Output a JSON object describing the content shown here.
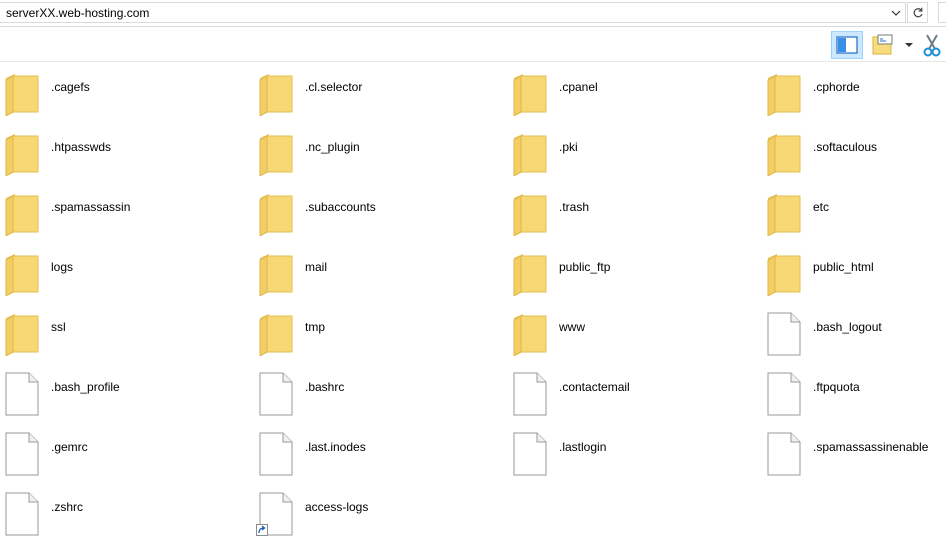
{
  "address": {
    "path": "serverXX.web-hosting.com",
    "dropdown_icon": "chevron-down-icon",
    "refresh_icon": "refresh-icon"
  },
  "toolbar": {
    "preview_pane_icon": "preview-pane-icon",
    "view_icon": "view-options-icon",
    "cut_icon": "scissors-icon",
    "accent": "#cce8ff"
  },
  "files": [
    {
      "name": ".cagefs",
      "type": "folder"
    },
    {
      "name": ".cl.selector",
      "type": "folder"
    },
    {
      "name": ".cpanel",
      "type": "folder"
    },
    {
      "name": ".cphorde",
      "type": "folder"
    },
    {
      "name": ".htpasswds",
      "type": "folder"
    },
    {
      "name": ".nc_plugin",
      "type": "folder"
    },
    {
      "name": ".pki",
      "type": "folder"
    },
    {
      "name": ".softaculous",
      "type": "folder"
    },
    {
      "name": ".spamassassin",
      "type": "folder"
    },
    {
      "name": ".subaccounts",
      "type": "folder"
    },
    {
      "name": ".trash",
      "type": "folder"
    },
    {
      "name": "etc",
      "type": "folder"
    },
    {
      "name": "logs",
      "type": "folder"
    },
    {
      "name": "mail",
      "type": "folder"
    },
    {
      "name": "public_ftp",
      "type": "folder"
    },
    {
      "name": "public_html",
      "type": "folder"
    },
    {
      "name": "ssl",
      "type": "folder"
    },
    {
      "name": "tmp",
      "type": "folder"
    },
    {
      "name": "www",
      "type": "folder"
    },
    {
      "name": ".bash_logout",
      "type": "file"
    },
    {
      "name": ".bash_profile",
      "type": "file"
    },
    {
      "name": ".bashrc",
      "type": "file"
    },
    {
      "name": ".contactemail",
      "type": "file"
    },
    {
      "name": ".ftpquota",
      "type": "file"
    },
    {
      "name": ".gemrc",
      "type": "file"
    },
    {
      "name": ".last.inodes",
      "type": "file"
    },
    {
      "name": ".lastlogin",
      "type": "file"
    },
    {
      "name": ".spamassassinenable",
      "type": "file"
    },
    {
      "name": ".zshrc",
      "type": "file"
    },
    {
      "name": "access-logs",
      "type": "shortcut"
    }
  ]
}
